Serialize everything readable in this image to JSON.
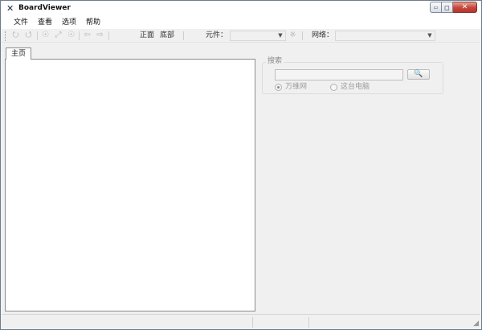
{
  "window": {
    "title": "BoardViewer"
  },
  "caption_buttons": {
    "minimize": "▭",
    "maximize": "◻",
    "close": "✕"
  },
  "menu": [
    "文件",
    "查看",
    "选项",
    "帮助"
  ],
  "toolbar": {
    "icons": [
      "zoom-in-icon",
      "zoom-out-icon",
      "zoom-area-icon",
      "fit-screen-icon",
      "zoom-window-icon",
      "back-arrow-icon",
      "forward-arrow-icon"
    ],
    "front_label": "正面",
    "bottom_label": "底部",
    "component_label": "元件：",
    "component_value": "",
    "net_label": "网络：",
    "net_value": ""
  },
  "tabs": {
    "home": "主页"
  },
  "search": {
    "group_label": "搜索",
    "input_value": "",
    "button_glyph": "🔍",
    "options": [
      {
        "label": "万维网",
        "selected": true
      },
      {
        "label": "这台电脑",
        "selected": false
      }
    ]
  },
  "colors": {
    "window_bg": "#f0f0f0",
    "close_button": "#c6443a",
    "disabled_text": "#9a9a9a"
  }
}
